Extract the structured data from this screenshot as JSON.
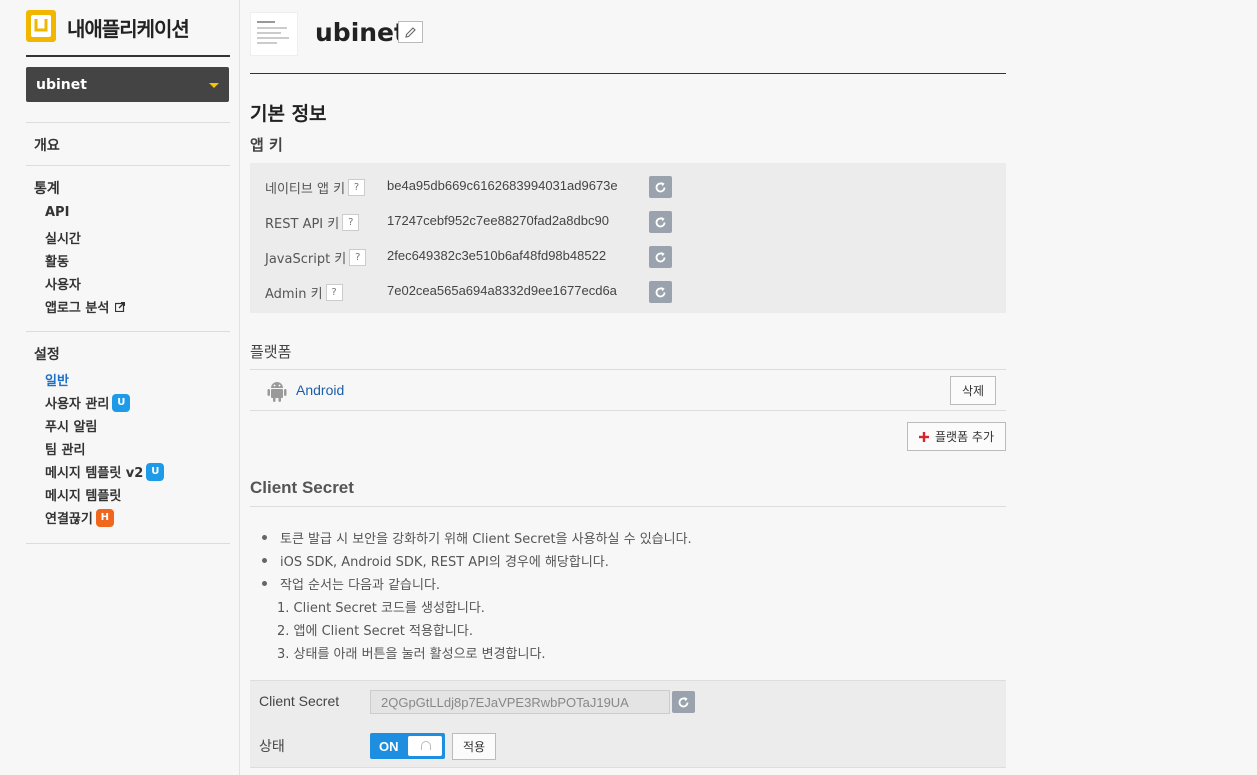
{
  "sidebar": {
    "title": "내애플리케이션",
    "selected_app": "ubinet",
    "overview": "개요",
    "stats": {
      "heading": "통계",
      "items": [
        {
          "label": "API"
        },
        {
          "label": "실시간"
        },
        {
          "label": "활동"
        },
        {
          "label": "사용자"
        },
        {
          "label": "앱로그 분석"
        }
      ]
    },
    "settings": {
      "heading": "설정",
      "items": [
        {
          "label": "일반",
          "active": true
        },
        {
          "label": "사용자 관리",
          "badge": "U"
        },
        {
          "label": "푸시 알림"
        },
        {
          "label": "팀 관리"
        },
        {
          "label": "메시지 템플릿 v2",
          "badge": "U"
        },
        {
          "label": "메시지 템플릿"
        },
        {
          "label": "연결끊기",
          "badge": "H"
        }
      ]
    }
  },
  "app": {
    "name": "ubinet"
  },
  "basic_info": {
    "title": "기본 정보",
    "app_keys_title": "앱 키",
    "keys": [
      {
        "label": "네이티브 앱 키",
        "value": "be4a95db669c6162683994031ad9673e"
      },
      {
        "label": "REST API 키",
        "value": "17247cebf952c7ee88270fad2a8dbc90"
      },
      {
        "label": "JavaScript 키",
        "value": "2fec649382c3e510b6af48fd98b48522"
      },
      {
        "label": "Admin 키",
        "value": "7e02cea565a694a8332d9ee1677ecd6a"
      }
    ],
    "help_mark": "?"
  },
  "platform": {
    "title": "플랫폼",
    "items": [
      {
        "name": "Android",
        "delete_label": "삭제"
      }
    ],
    "add_label": "플랫폼 추가"
  },
  "client_secret": {
    "title": "Client Secret",
    "bullets": [
      "토큰 발급 시 보안을 강화하기 위해 Client Secret을 사용하실 수 있습니다.",
      "iOS SDK, Android SDK, REST API의 경우에 해당합니다.",
      "작업 순서는 다음과 같습니다."
    ],
    "steps": [
      "1. Client Secret 코드를 생성합니다.",
      "2. 앱에 Client Secret 적용합니다.",
      "3. 상태를 아래 버튼을 눌러 활성으로 변경합니다."
    ],
    "secret_label": "Client Secret",
    "secret_value": "2QGpGtLLdj8p7EJaVPE3RwbPOTaJ19UA",
    "status_label": "상태",
    "toggle_label": "ON",
    "apply_label": "적용"
  },
  "colors": {
    "accent": "#1c70c9",
    "toggle_on": "#1e8fe0",
    "badge_update": "#1e9be8",
    "badge_hot": "#f0661d"
  }
}
